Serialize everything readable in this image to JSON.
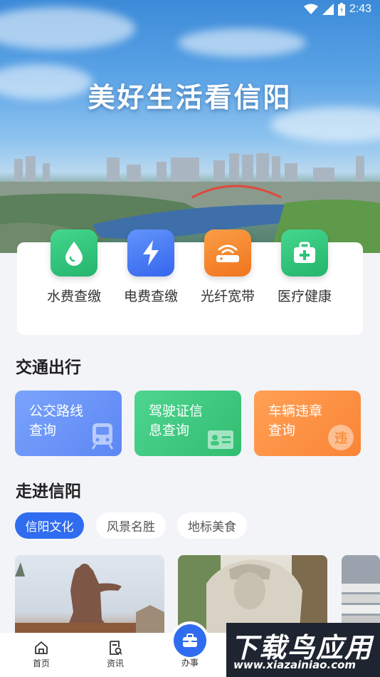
{
  "status_bar": {
    "time": "2:43"
  },
  "hero": {
    "title": "美好生活看信阳"
  },
  "services": [
    {
      "label": "水费查缴",
      "icon": "water-drop-icon",
      "color": "#2ec27a"
    },
    {
      "label": "电费查缴",
      "icon": "lightning-icon",
      "color": "#3f7cf5"
    },
    {
      "label": "光纤宽带",
      "icon": "router-icon",
      "color": "#f5862e"
    },
    {
      "label": "医疗健康",
      "icon": "medical-kit-icon",
      "color": "#2ec27a"
    }
  ],
  "traffic": {
    "title": "交通出行",
    "cards": [
      {
        "line1": "公交路线",
        "line2": "查询",
        "icon": "bus-icon",
        "color": "#6b93f7"
      },
      {
        "line1": "驾驶证信",
        "line2": "息查询",
        "icon": "id-card-icon",
        "color": "#3ec97e"
      },
      {
        "line1": "车辆违章",
        "line2": "查询",
        "icon": "violation-icon",
        "color": "#fb8f3d",
        "icon_text": "违"
      }
    ]
  },
  "explore": {
    "title": "走进信阳",
    "chips": [
      "信阳文化",
      "风景名胜",
      "地标美食"
    ],
    "selected_chip": 0
  },
  "bottom_nav": {
    "items": [
      {
        "label": "首页",
        "icon": "home-icon"
      },
      {
        "label": "资讯",
        "icon": "news-icon"
      },
      {
        "label": "办事",
        "icon": "briefcase-icon"
      }
    ]
  },
  "watermark": {
    "main": "下载鸟应用",
    "sub": "www.xiazainiao.com"
  },
  "colors": {
    "primary": "#2f6cf0",
    "background": "#f2f4f8"
  }
}
